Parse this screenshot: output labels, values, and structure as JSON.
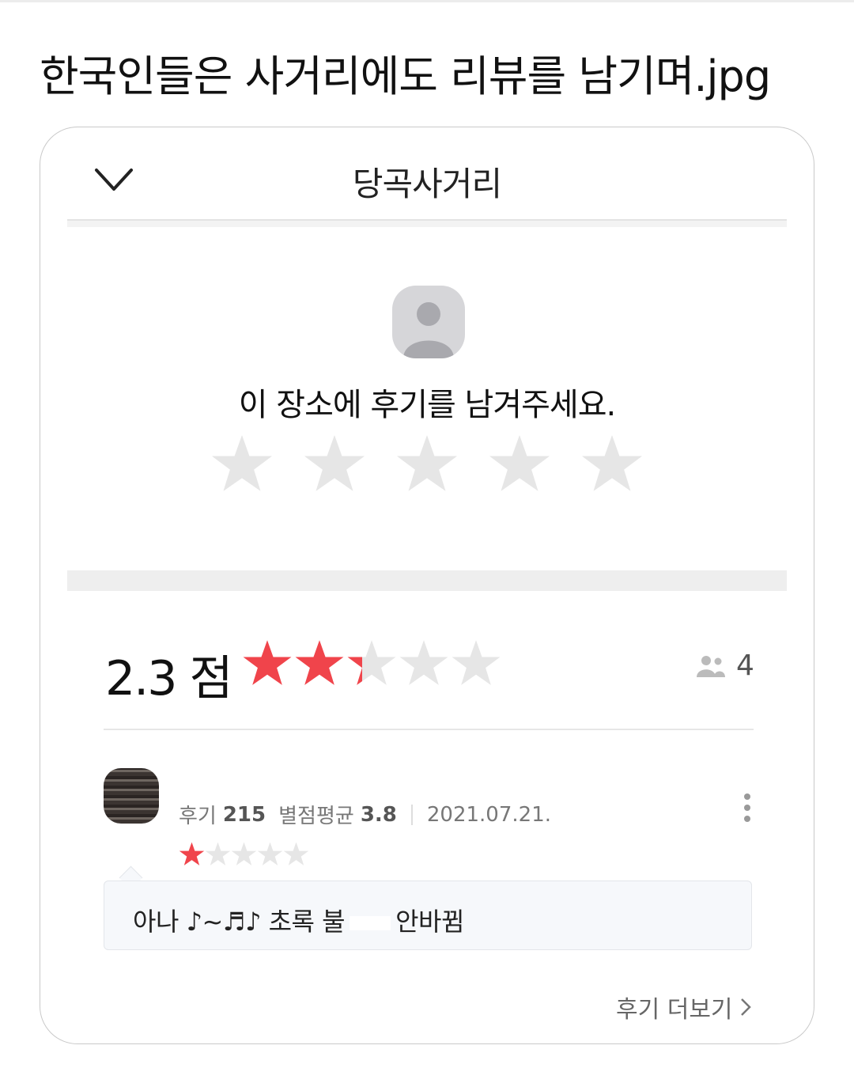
{
  "post": {
    "title": "한국인들은 사거리에도 리뷰를 남기며.jpg"
  },
  "place": {
    "name": "당곡사거리"
  },
  "write_review": {
    "prompt": "이 장소에 후기를 남겨주세요.",
    "star_count": 5,
    "star_color": "#e6e6e6"
  },
  "rating": {
    "score_text": "2.3 점",
    "average": 2.3,
    "max": 5,
    "reviewer_count": "4",
    "filled_color": "#f0444b",
    "empty_color": "#e6e6e6"
  },
  "review": {
    "meta_prefix": "후기",
    "review_count": "215",
    "avg_label": "별점평균",
    "avg_value": "3.8",
    "date": "2021.07.21.",
    "stars": 1,
    "text_before": "아나 ♪~♬♪ 초록 불",
    "text_after": "안바뀜"
  },
  "footer": {
    "more_label": "후기 더보기"
  }
}
